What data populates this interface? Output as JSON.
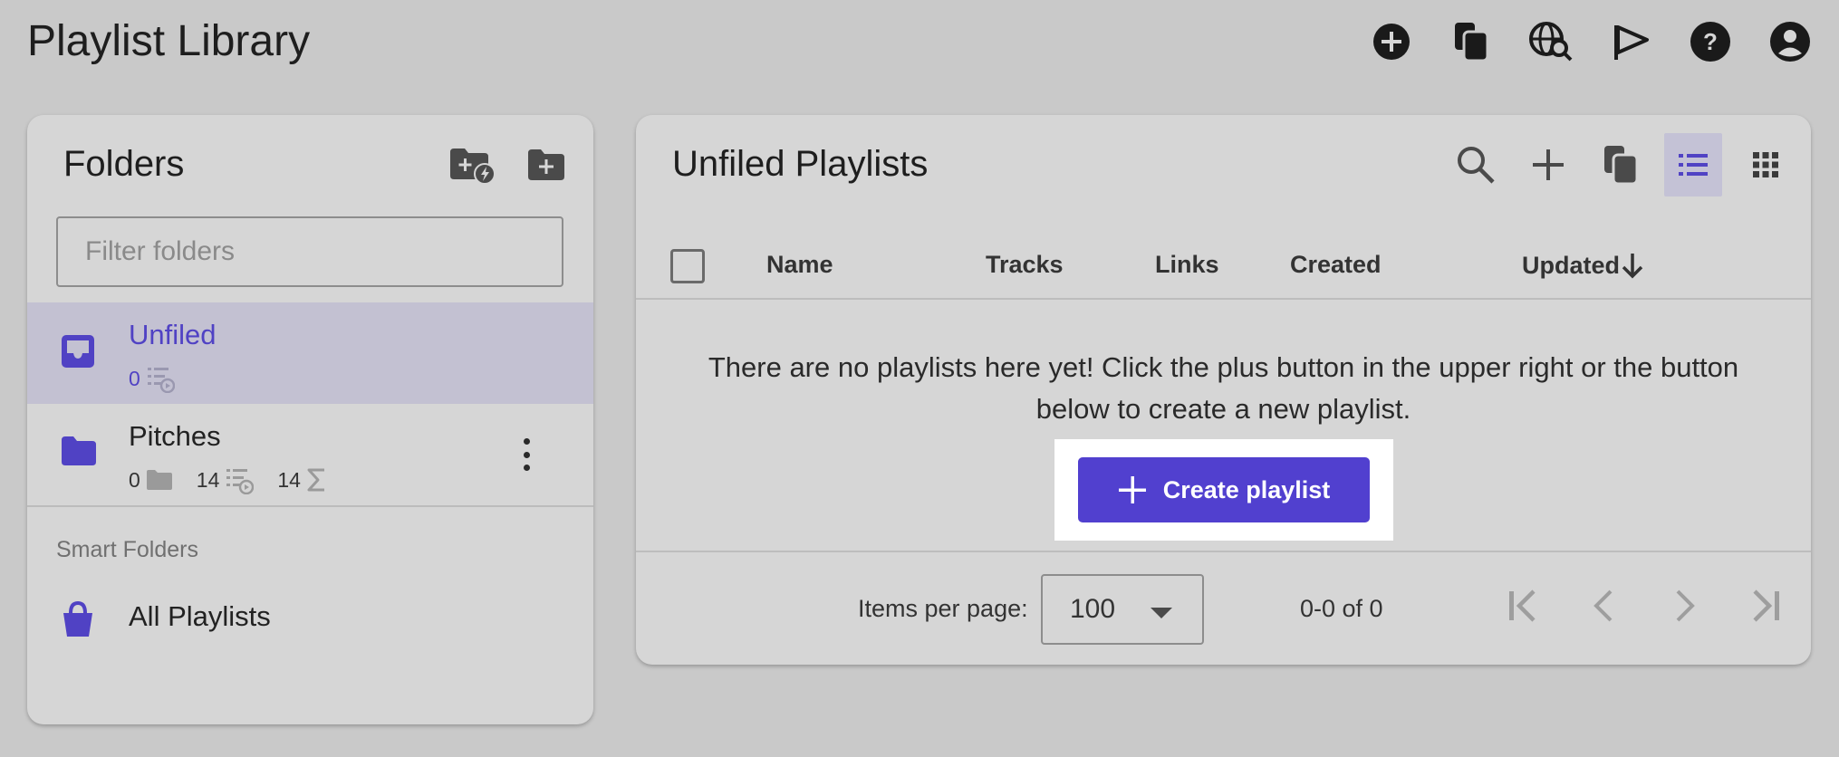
{
  "page": {
    "title": "Playlist Library"
  },
  "header": {
    "actions": [
      {
        "icon": "add-circle-icon"
      },
      {
        "icon": "copy-icon"
      },
      {
        "icon": "web-search-icon"
      },
      {
        "icon": "campaign-icon"
      },
      {
        "icon": "help-icon"
      },
      {
        "icon": "account-icon"
      }
    ]
  },
  "folders": {
    "title": "Folders",
    "filter_placeholder": "Filter folders",
    "actions": [
      {
        "icon": "create-smart-folder-icon"
      },
      {
        "icon": "create-folder-icon"
      }
    ],
    "items": [
      {
        "name": "Unfiled",
        "icon": "inbox-icon",
        "playlists": "0",
        "selected": true
      },
      {
        "name": "Pitches",
        "icon": "folder-icon",
        "subfolders": "0",
        "playlists": "14",
        "total": "14",
        "selected": false
      }
    ],
    "smart_label": "Smart Folders",
    "smart_items": [
      {
        "name": "All Playlists",
        "icon": "basket-icon"
      }
    ]
  },
  "playlists": {
    "title": "Unfiled Playlists",
    "columns": {
      "name": "Name",
      "tracks": "Tracks",
      "links": "Links",
      "created": "Created",
      "updated": "Updated"
    },
    "empty_message": "There are no playlists here yet! Click the plus button in the upper right or the button below to create a new playlist.",
    "create_label": "Create playlist",
    "items_per_page_label": "Items per page:",
    "items_per_page": "100",
    "range": "0-0 of 0"
  },
  "colors": {
    "accent": "#5140cf",
    "background": "#c9c9c9",
    "card": "#d6d6d6",
    "selected_row": "#c3c1d2"
  }
}
